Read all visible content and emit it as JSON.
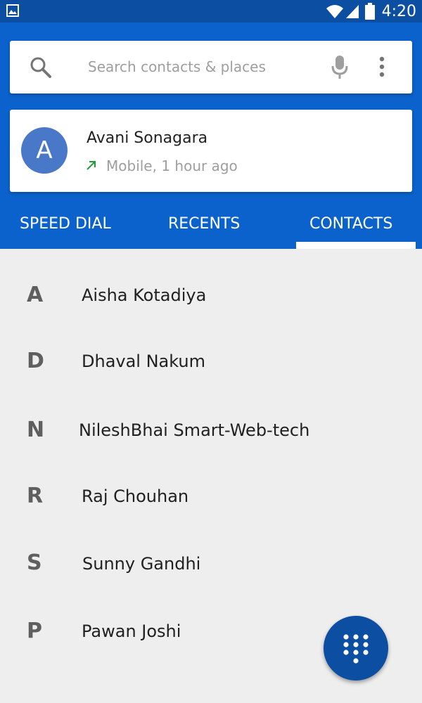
{
  "status_bar": {
    "time": "4:20",
    "icons": [
      "image-notification-icon",
      "wifi-icon",
      "signal-icon",
      "battery-icon"
    ]
  },
  "search": {
    "placeholder": "Search contacts & places",
    "icons": [
      "search-icon",
      "mic-icon",
      "more-vert-icon"
    ]
  },
  "recent_call": {
    "avatar_letter": "A",
    "name": "Avani Sonagara",
    "detail": "Mobile, 1 hour ago",
    "icon": "outgoing-call-arrow-icon"
  },
  "tabs": [
    {
      "label": "SPEED DIAL"
    },
    {
      "label": "RECENTS"
    },
    {
      "label": "CONTACTS",
      "selected": true
    }
  ],
  "contacts": [
    {
      "letter": "A",
      "name": "Aisha Kotadiya"
    },
    {
      "letter": "D",
      "name": "Dhaval Nakum"
    },
    {
      "letter": "N",
      "name": "NileshBhai Smart-Web-tech"
    },
    {
      "letter": "R",
      "name": "Raj Chouhan"
    },
    {
      "letter": "S",
      "name": "Sunny Gandhi"
    },
    {
      "letter": "P",
      "name": "Pawan Joshi"
    }
  ],
  "fab": {
    "icon": "dialpad-icon"
  },
  "colors": {
    "status_bar": "#0b4ea2",
    "header": "#0b62cc",
    "avatar": "#4a78c9",
    "fab": "#0b4ea2",
    "background": "#eeeeee",
    "call_arrow": "#1e9e3a"
  }
}
